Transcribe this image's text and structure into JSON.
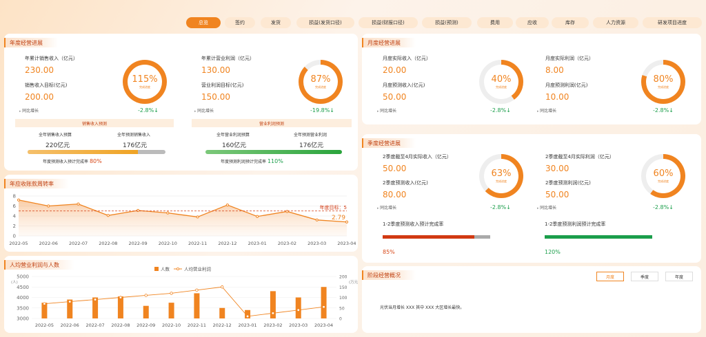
{
  "colors": {
    "accent": "#f08420",
    "up_green": "#1b9e4b",
    "down_red": "#d84a1b"
  },
  "nav": {
    "tabs": [
      "总览",
      "签约",
      "发货",
      "损益(发货口径)",
      "损益(财报口径)",
      "损益(预测)",
      "费用",
      "应收",
      "库存",
      "人力资源",
      "研发项目进度"
    ],
    "active": 0
  },
  "annual": {
    "title": "年度经营进展",
    "left": {
      "l1": "年累计销售收入（亿元）",
      "v1": "230.00",
      "l2": "销售收入目标(亿元)",
      "v2": "200.00",
      "yoy": "同比增长",
      "change": "-2.8%↓",
      "ring_pct": "115%",
      "ring_sub": "完成进度",
      "ring_fill": 1.0
    },
    "right": {
      "l1": "年累计营业利润（亿元）",
      "v1": "130.00",
      "l2": "营业利润目标(亿元)",
      "v2": "150.00",
      "yoy": "同比增长",
      "change": "-19.8%↓",
      "ring_pct": "87%",
      "ring_sub": "完成进度",
      "ring_fill": 0.87
    },
    "sales_fc": {
      "title": "销售收入预测",
      "h1": "全年销售收入预算",
      "v1": "220亿元",
      "h2": "全年预测销售收入",
      "v2": "176亿元",
      "rate_label": "年度预测收入预计完成率",
      "rate": "80%",
      "fill": 0.8
    },
    "profit_fc": {
      "title": "营业利润预测",
      "h1": "全年营业利润预算",
      "v1": "160亿元",
      "h2": "全年预测营业利润",
      "v2": "176亿元",
      "rate_label": "年度预测利润预计完成率",
      "rate": "110%",
      "fill": 1.0
    }
  },
  "turnover": {
    "title": "年应收账款周转率",
    "target_label": "年度目标：5",
    "last_label": "2.79",
    "chart_data": {
      "type": "area",
      "x": [
        "2022-05",
        "2022-06",
        "2022-07",
        "2022-08",
        "2022-09",
        "2022-10",
        "2022-11",
        "2022-12",
        "2023-01",
        "2023-02",
        "2023-03",
        "2023-04"
      ],
      "values": [
        7.2,
        6.0,
        6.4,
        4.1,
        5.1,
        4.6,
        3.8,
        6.2,
        3.9,
        4.9,
        3.2,
        2.79
      ],
      "target": 5,
      "ylim": [
        0,
        8
      ],
      "yticks": [
        "0",
        "2",
        "4",
        "6",
        "8"
      ]
    }
  },
  "percap": {
    "title": "人均营业利润与人数",
    "legend": {
      "bar": "人数",
      "line": "人均营业利润"
    },
    "y_left_unit": "(人)",
    "y_right_unit": "(万元)",
    "chart_data": {
      "type": "bar+line",
      "x": [
        "2022-05",
        "2022-06",
        "2022-07",
        "2022-08",
        "2022-09",
        "2022-10",
        "2022-11",
        "2022-12",
        "2023-01",
        "2023-02",
        "2023-03",
        "2023-04"
      ],
      "series": [
        {
          "name": "人数",
          "values": [
            3750,
            3900,
            4000,
            4050,
            3600,
            3750,
            4200,
            3500,
            3400,
            4300,
            4000,
            4500
          ]
        },
        {
          "name": "人均营业利润",
          "values": [
            70,
            80,
            90,
            100,
            110,
            120,
            135,
            150,
            10,
            25,
            40,
            55
          ]
        }
      ],
      "y_left": [
        3000,
        5000
      ],
      "y_left_ticks": [
        "3000",
        "3500",
        "4000",
        "4500",
        "5000"
      ],
      "y_right": [
        0,
        200
      ],
      "y_right_ticks": [
        "0",
        "50",
        "100",
        "150",
        "200"
      ]
    }
  },
  "monthly": {
    "title": "月度经营进展",
    "left": {
      "l1": "月度实际收入（亿元）",
      "v1": "20.00",
      "l2": "月度预测收入(亿元)",
      "v2": "50.00",
      "yoy": "同比增长",
      "change": "-2.8%↓",
      "ring_pct": "40%",
      "ring_sub": "完成进度",
      "ring_fill": 0.4
    },
    "right": {
      "l1": "月度实际利润（亿元）",
      "v1": "8.00",
      "l2": "月度预测利润(亿元)",
      "v2": "10.00",
      "yoy": "同比增长",
      "change": "-2.8%↓",
      "ring_pct": "80%",
      "ring_sub": "完成进度",
      "ring_fill": 0.8
    }
  },
  "quarter": {
    "title": "季度经营进展",
    "left": {
      "l1": "2季度截至4月实际收入（亿元）",
      "v1": "50.00",
      "l2": "2季度预测收入(亿元)",
      "v2": "80.00",
      "yoy": "同比增长",
      "change": "-2.8%↓",
      "ring_pct": "63%",
      "ring_sub": "完成进度",
      "ring_fill": 0.63,
      "rate_label": "1-2季度预测收入预计完成率",
      "rate": "85%",
      "fill": 0.85
    },
    "right": {
      "l1": "2季度截至4月实际利润（亿元）",
      "v1": "30.00",
      "l2": "2季度预测利润(亿元)",
      "v2": "50.00",
      "yoy": "同比增长",
      "change": "-2.8%↓",
      "ring_pct": "60%",
      "ring_sub": "完成进度",
      "ring_fill": 0.6,
      "rate_label": "1-2季度预测利润预计完成率",
      "rate": "120%",
      "fill": 1.0
    }
  },
  "stage": {
    "title": "阶段经营概况",
    "tabs": [
      "月度",
      "季度",
      "年度"
    ],
    "text": "光伏当月增长 XXX 其中 XXX 大区增长最快。"
  }
}
